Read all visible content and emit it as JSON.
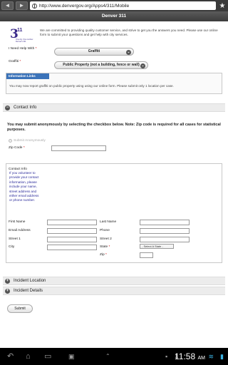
{
  "browser": {
    "back": "◄",
    "forward": "►",
    "url": "http://www.denvergov.org/Apps4/311/Mobile"
  },
  "app_title": "Denver 311",
  "logo": {
    "number": "3",
    "superscript": "11",
    "tagline": "One city. One number. Denver's 311"
  },
  "intro": "We are committed to providing quality customer service, and strive to get you the answers you need. Please use our online form to submit your questions and get help with city services.",
  "need_help": {
    "label": "I Need Help With",
    "required": "*",
    "value": "Graffiti"
  },
  "graffiti": {
    "label": "Graffiti",
    "required": "*",
    "value": "Public Property (not a building, fence or wall)"
  },
  "info": {
    "header": "Information Links",
    "text": "You may now report graffiti on public property using using our online form. Please submit only 1 location per case."
  },
  "sections": {
    "contact": "Contact Info",
    "incident_location": "Incident Location",
    "incident_details": "Incident Details"
  },
  "anonymous": {
    "notice": "You may submit anonymously by selecting the checkbox below. Note: Zip code is required for all cases for statistical purposes.",
    "checkbox_label": "Submit Anonymously",
    "zip_label": "Zip Code",
    "required": "*"
  },
  "contact_info": {
    "title": "Contact Info",
    "note": "If you volunteer to provide your contact information, please include your name, street address and either email address or phone number.",
    "first_name": "First Name",
    "last_name": "Last Name",
    "email": "Email Address",
    "phone": "Phone",
    "street1": "Street 1",
    "street2": "Street 2",
    "city": "City",
    "state": "State",
    "state_placeholder": "- Select A State -",
    "zip": "Zip",
    "required": "*"
  },
  "submit_label": "Submit",
  "status_bar": {
    "time": "11:58",
    "ampm": "AM"
  }
}
